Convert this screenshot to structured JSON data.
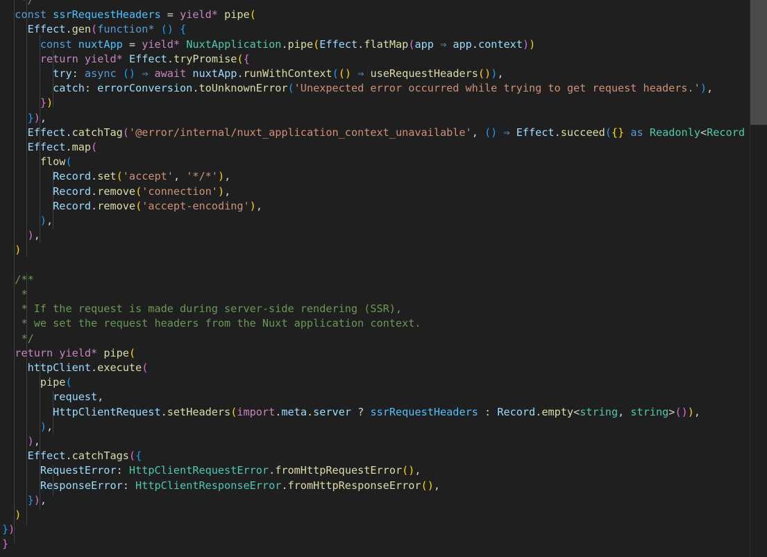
{
  "editor": {
    "language": "typescript",
    "lines": [
      [
        [
          "   ",
          "df"
        ],
        [
          "*/",
          "cm"
        ]
      ],
      [
        [
          "  ",
          "df"
        ],
        [
          "const",
          "lb"
        ],
        [
          " ",
          "df"
        ],
        [
          "ssrRequestHeaders",
          "cv"
        ],
        [
          " = ",
          "df"
        ],
        [
          "yield*",
          "pk"
        ],
        [
          " ",
          "df"
        ],
        [
          "pipe",
          "fn"
        ],
        [
          "(",
          "b1"
        ]
      ],
      [
        [
          "    ",
          "df"
        ],
        [
          "Effect",
          "va"
        ],
        [
          ".",
          "df"
        ],
        [
          "gen",
          "fn"
        ],
        [
          "(",
          "b2"
        ],
        [
          "function*",
          "lb"
        ],
        [
          " ",
          "df"
        ],
        [
          "()",
          "b3"
        ],
        [
          " ",
          "df"
        ],
        [
          "{",
          "b3"
        ]
      ],
      [
        [
          "      ",
          "df"
        ],
        [
          "const",
          "lb"
        ],
        [
          " ",
          "df"
        ],
        [
          "nuxtApp",
          "cv"
        ],
        [
          " = ",
          "df"
        ],
        [
          "yield*",
          "pk"
        ],
        [
          " ",
          "df"
        ],
        [
          "NuxtApplication",
          "ty"
        ],
        [
          ".",
          "df"
        ],
        [
          "pipe",
          "fn"
        ],
        [
          "(",
          "b1"
        ],
        [
          "Effect",
          "va"
        ],
        [
          ".",
          "df"
        ],
        [
          "flatMap",
          "fn"
        ],
        [
          "(",
          "b2"
        ],
        [
          "app",
          "va"
        ],
        [
          " ⇒ ",
          "lb"
        ],
        [
          "app",
          "va"
        ],
        [
          ".",
          "df"
        ],
        [
          "context",
          "va"
        ],
        [
          ")",
          "b2"
        ],
        [
          ")",
          "b1"
        ]
      ],
      [
        [
          "      ",
          "df"
        ],
        [
          "return",
          "pk"
        ],
        [
          " ",
          "df"
        ],
        [
          "yield*",
          "pk"
        ],
        [
          " ",
          "df"
        ],
        [
          "Effect",
          "va"
        ],
        [
          ".",
          "df"
        ],
        [
          "tryPromise",
          "fn"
        ],
        [
          "(",
          "b1"
        ],
        [
          "{",
          "b2"
        ]
      ],
      [
        [
          "        ",
          "df"
        ],
        [
          "try",
          "va"
        ],
        [
          ": ",
          "df"
        ],
        [
          "async",
          "lb"
        ],
        [
          " ",
          "df"
        ],
        [
          "()",
          "b3"
        ],
        [
          " ⇒ ",
          "lb"
        ],
        [
          "await",
          "pk"
        ],
        [
          " ",
          "df"
        ],
        [
          "nuxtApp",
          "va"
        ],
        [
          ".",
          "df"
        ],
        [
          "runWithContext",
          "fn"
        ],
        [
          "(",
          "b3"
        ],
        [
          "()",
          "b1"
        ],
        [
          " ⇒ ",
          "lb"
        ],
        [
          "useRequestHeaders",
          "fn"
        ],
        [
          "()",
          "b1"
        ],
        [
          ")",
          "b3"
        ],
        [
          ",",
          "df"
        ]
      ],
      [
        [
          "        ",
          "df"
        ],
        [
          "catch",
          "va"
        ],
        [
          ": ",
          "df"
        ],
        [
          "errorConversion",
          "va"
        ],
        [
          ".",
          "df"
        ],
        [
          "toUnknownError",
          "fn"
        ],
        [
          "(",
          "b3"
        ],
        [
          "'Unexpected error occurred while trying to get request headers.'",
          "st"
        ],
        [
          ")",
          "b3"
        ],
        [
          ",",
          "df"
        ]
      ],
      [
        [
          "      ",
          "df"
        ],
        [
          "}",
          "b2"
        ],
        [
          ")",
          "b1"
        ]
      ],
      [
        [
          "    ",
          "df"
        ],
        [
          "}",
          "b3"
        ],
        [
          ")",
          "b2"
        ],
        [
          ",",
          "df"
        ]
      ],
      [
        [
          "    ",
          "df"
        ],
        [
          "Effect",
          "va"
        ],
        [
          ".",
          "df"
        ],
        [
          "catchTag",
          "fn"
        ],
        [
          "(",
          "b2"
        ],
        [
          "'@error/internal/nuxt_application_context_unavailable'",
          "st"
        ],
        [
          ", ",
          "df"
        ],
        [
          "()",
          "b3"
        ],
        [
          " ⇒ ",
          "lb"
        ],
        [
          "Effect",
          "va"
        ],
        [
          ".",
          "df"
        ],
        [
          "succeed",
          "fn"
        ],
        [
          "(",
          "b3"
        ],
        [
          "{}",
          "b1"
        ],
        [
          " ",
          "df"
        ],
        [
          "as",
          "lb"
        ],
        [
          " ",
          "df"
        ],
        [
          "Readonly",
          "ty"
        ],
        [
          "<",
          "df"
        ],
        [
          "Record",
          "ty"
        ]
      ],
      [
        [
          "    ",
          "df"
        ],
        [
          "Effect",
          "va"
        ],
        [
          ".",
          "df"
        ],
        [
          "map",
          "fn"
        ],
        [
          "(",
          "b2"
        ]
      ],
      [
        [
          "      ",
          "df"
        ],
        [
          "flow",
          "fn"
        ],
        [
          "(",
          "b3"
        ]
      ],
      [
        [
          "        ",
          "df"
        ],
        [
          "Record",
          "va"
        ],
        [
          ".",
          "df"
        ],
        [
          "set",
          "fn"
        ],
        [
          "(",
          "b1"
        ],
        [
          "'accept'",
          "st"
        ],
        [
          ", ",
          "df"
        ],
        [
          "'*/*'",
          "st"
        ],
        [
          ")",
          "b1"
        ],
        [
          ",",
          "df"
        ]
      ],
      [
        [
          "        ",
          "df"
        ],
        [
          "Record",
          "va"
        ],
        [
          ".",
          "df"
        ],
        [
          "remove",
          "fn"
        ],
        [
          "(",
          "b1"
        ],
        [
          "'connection'",
          "st"
        ],
        [
          ")",
          "b1"
        ],
        [
          ",",
          "df"
        ]
      ],
      [
        [
          "        ",
          "df"
        ],
        [
          "Record",
          "va"
        ],
        [
          ".",
          "df"
        ],
        [
          "remove",
          "fn"
        ],
        [
          "(",
          "b1"
        ],
        [
          "'accept-encoding'",
          "st"
        ],
        [
          ")",
          "b1"
        ],
        [
          ",",
          "df"
        ]
      ],
      [
        [
          "      ",
          "df"
        ],
        [
          ")",
          "b3"
        ],
        [
          ",",
          "df"
        ]
      ],
      [
        [
          "    ",
          "df"
        ],
        [
          ")",
          "b2"
        ],
        [
          ",",
          "df"
        ]
      ],
      [
        [
          "  ",
          "df"
        ],
        [
          ")",
          "b1"
        ]
      ],
      [
        [
          "",
          "df"
        ]
      ],
      [
        [
          "  ",
          "df"
        ],
        [
          "/**",
          "cm"
        ]
      ],
      [
        [
          "   ",
          "df"
        ],
        [
          "*",
          "cm"
        ]
      ],
      [
        [
          "   ",
          "df"
        ],
        [
          "* If the request is made during server-side rendering (SSR),",
          "cm"
        ]
      ],
      [
        [
          "   ",
          "df"
        ],
        [
          "* we set the request headers from the Nuxt application context.",
          "cm"
        ]
      ],
      [
        [
          "   ",
          "df"
        ],
        [
          "*/",
          "cm"
        ]
      ],
      [
        [
          "  ",
          "df"
        ],
        [
          "return",
          "pk"
        ],
        [
          " ",
          "df"
        ],
        [
          "yield*",
          "pk"
        ],
        [
          " ",
          "df"
        ],
        [
          "pipe",
          "fn"
        ],
        [
          "(",
          "b1"
        ]
      ],
      [
        [
          "    ",
          "df"
        ],
        [
          "httpClient",
          "va"
        ],
        [
          ".",
          "df"
        ],
        [
          "execute",
          "fn"
        ],
        [
          "(",
          "b2"
        ]
      ],
      [
        [
          "      ",
          "df"
        ],
        [
          "pipe",
          "fn"
        ],
        [
          "(",
          "b3"
        ]
      ],
      [
        [
          "        ",
          "df"
        ],
        [
          "request",
          "va"
        ],
        [
          ",",
          "df"
        ]
      ],
      [
        [
          "        ",
          "df"
        ],
        [
          "HttpClientRequest",
          "va"
        ],
        [
          ".",
          "df"
        ],
        [
          "setHeaders",
          "fn"
        ],
        [
          "(",
          "b1"
        ],
        [
          "import",
          "pk"
        ],
        [
          ".",
          "df"
        ],
        [
          "meta",
          "va"
        ],
        [
          ".",
          "df"
        ],
        [
          "server",
          "va"
        ],
        [
          " ? ",
          "df"
        ],
        [
          "ssrRequestHeaders",
          "cv"
        ],
        [
          " : ",
          "df"
        ],
        [
          "Record",
          "va"
        ],
        [
          ".",
          "df"
        ],
        [
          "empty",
          "fn"
        ],
        [
          "<",
          "df"
        ],
        [
          "string",
          "ty"
        ],
        [
          ", ",
          "df"
        ],
        [
          "string",
          "ty"
        ],
        [
          ">",
          "df"
        ],
        [
          "()",
          "b2"
        ],
        [
          ")",
          "b1"
        ],
        [
          ",",
          "df"
        ]
      ],
      [
        [
          "      ",
          "df"
        ],
        [
          ")",
          "b3"
        ],
        [
          ",",
          "df"
        ]
      ],
      [
        [
          "    ",
          "df"
        ],
        [
          ")",
          "b2"
        ],
        [
          ",",
          "df"
        ]
      ],
      [
        [
          "    ",
          "df"
        ],
        [
          "Effect",
          "va"
        ],
        [
          ".",
          "df"
        ],
        [
          "catchTags",
          "fn"
        ],
        [
          "(",
          "b2"
        ],
        [
          "{",
          "b3"
        ]
      ],
      [
        [
          "      ",
          "df"
        ],
        [
          "RequestError",
          "va"
        ],
        [
          ": ",
          "df"
        ],
        [
          "HttpClientRequestError",
          "ty"
        ],
        [
          ".",
          "df"
        ],
        [
          "fromHttpRequestError",
          "fn"
        ],
        [
          "()",
          "b1"
        ],
        [
          ",",
          "df"
        ]
      ],
      [
        [
          "      ",
          "df"
        ],
        [
          "ResponseError",
          "va"
        ],
        [
          ": ",
          "df"
        ],
        [
          "HttpClientResponseError",
          "ty"
        ],
        [
          ".",
          "df"
        ],
        [
          "fromHttpResponseError",
          "fn"
        ],
        [
          "()",
          "b1"
        ],
        [
          ",",
          "df"
        ]
      ],
      [
        [
          "    ",
          "df"
        ],
        [
          "}",
          "b3"
        ],
        [
          ")",
          "b2"
        ],
        [
          ",",
          "df"
        ]
      ],
      [
        [
          "  ",
          "df"
        ],
        [
          ")",
          "b1"
        ]
      ],
      [
        [
          "",
          "df"
        ],
        [
          "}",
          "b3"
        ],
        [
          ")",
          "b2"
        ]
      ],
      [
        [
          "}",
          "b2"
        ]
      ]
    ]
  }
}
